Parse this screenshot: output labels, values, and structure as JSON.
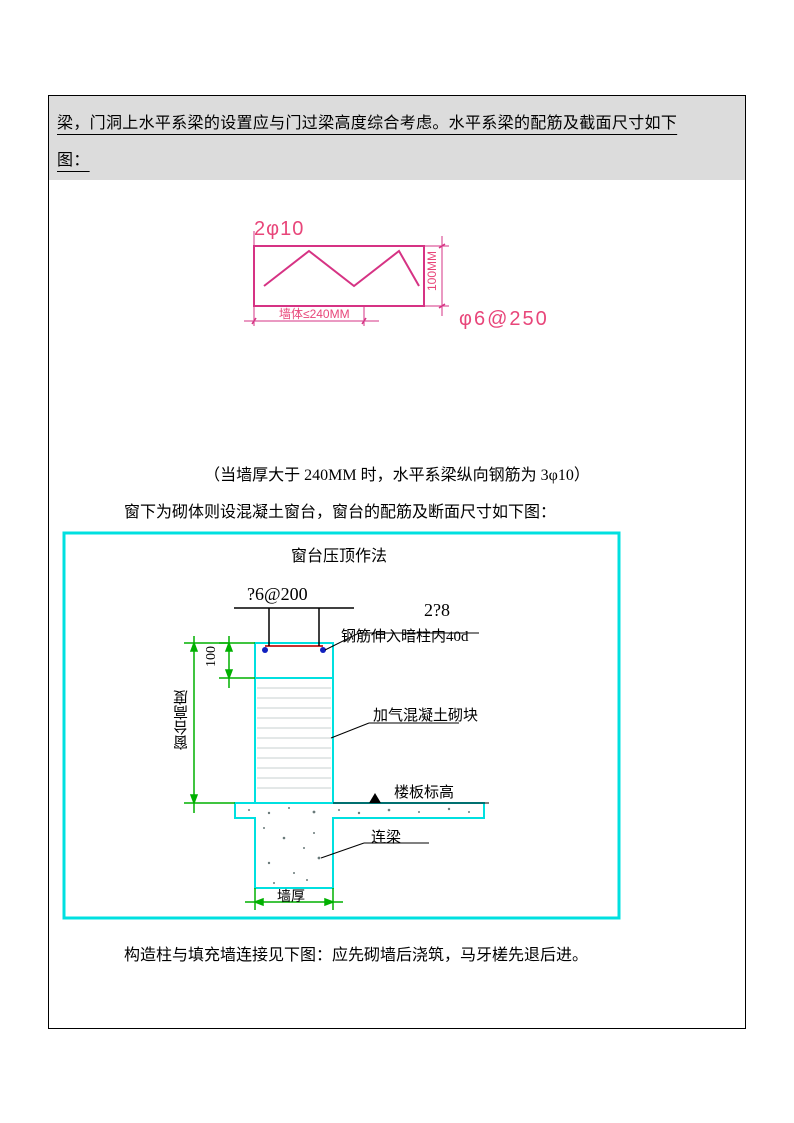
{
  "paragraph1": "梁，门洞上水平系梁的设置应与门过梁高度综合考虑。水平系梁的配筋及截面尺寸如下图：",
  "caption_mid": "（当墙厚大于 240MM 时，水平系梁纵向钢筋为 3φ10）",
  "caption2": "窗下为砌体则设混凝土窗台，窗台的配筋及断面尺寸如下图：",
  "caption3": "构造柱与填充墙连接见下图：应先砌墙后浇筑，马牙槎先退后进。",
  "diagram1": {
    "top_label": "2φ10",
    "right_dim": "100MM",
    "bottom_label": "墙体≤240MM",
    "right_label": "φ6@250"
  },
  "diagram2": {
    "title": "窗台压顶作法",
    "rebar_label": "?6@200",
    "rebar_right": "2?8",
    "rebar_note": "钢筋伸入暗柱内40d",
    "block_label": "加气混凝土砌块",
    "floor_label": "楼板标高",
    "beam_label": "连梁",
    "wall_label": "墙厚",
    "height_label": "窗台高度",
    "dim_100": "100"
  }
}
